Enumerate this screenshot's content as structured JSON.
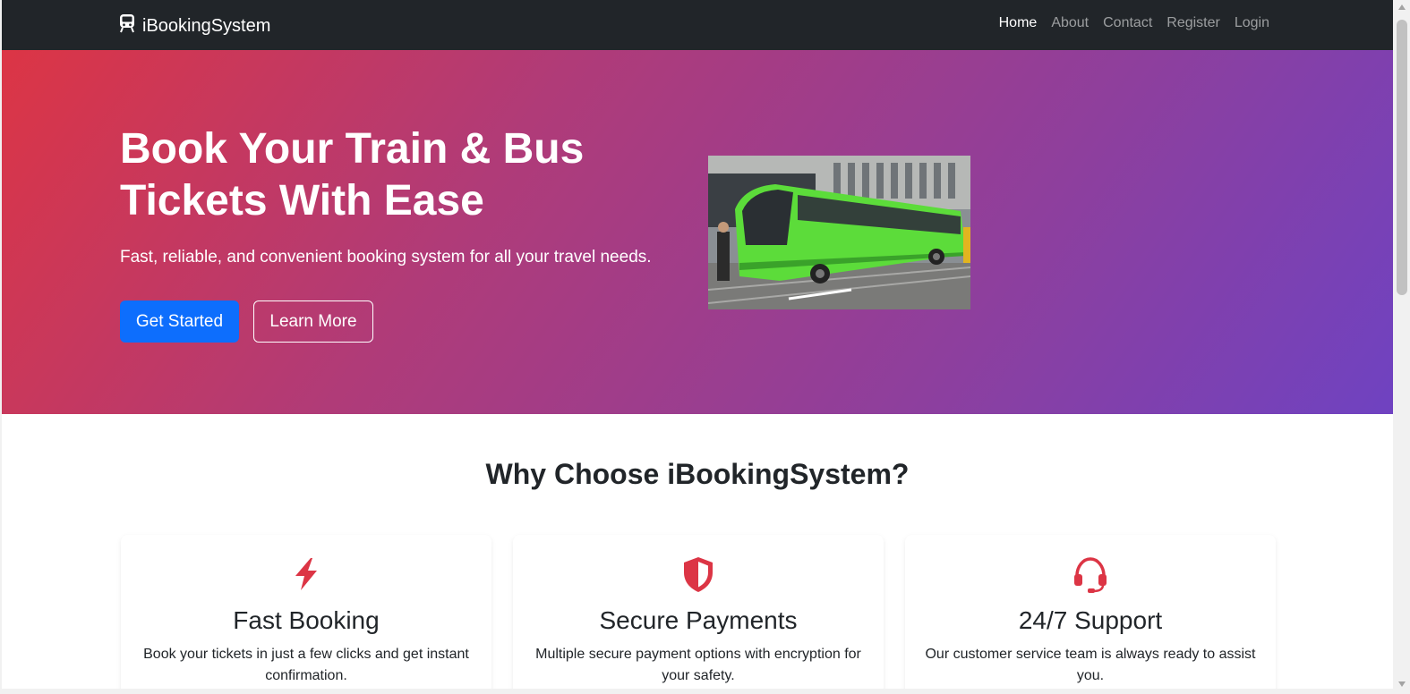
{
  "navbar": {
    "brand": "iBookingSystem",
    "brand_icon": "train-icon",
    "links": [
      {
        "label": "Home",
        "active": true
      },
      {
        "label": "About",
        "active": false
      },
      {
        "label": "Contact",
        "active": false
      },
      {
        "label": "Register",
        "active": false
      },
      {
        "label": "Login",
        "active": false
      }
    ]
  },
  "hero": {
    "title": "Book Your Train & Bus Tickets With Ease",
    "subtitle": "Fast, reliable, and convenient booking system for all your travel needs.",
    "primary_button": "Get Started",
    "secondary_button": "Learn More",
    "image": "green-bus-image",
    "gradient": [
      "#dc3545",
      "#6f42c1"
    ]
  },
  "features": {
    "title": "Why Choose iBookingSystem?",
    "icon_color": "#dc3545",
    "cards": [
      {
        "icon": "lightning-icon",
        "title": "Fast Booking",
        "text": "Book your tickets in just a few clicks and get instant confirmation."
      },
      {
        "icon": "shield-icon",
        "title": "Secure Payments",
        "text": "Multiple secure payment options with encryption for your safety."
      },
      {
        "icon": "headset-icon",
        "title": "24/7 Support",
        "text": "Our customer service team is always ready to assist you."
      }
    ]
  },
  "colors": {
    "navbar": "#212529",
    "primary": "#0d6efd",
    "accent": "#dc3545"
  }
}
